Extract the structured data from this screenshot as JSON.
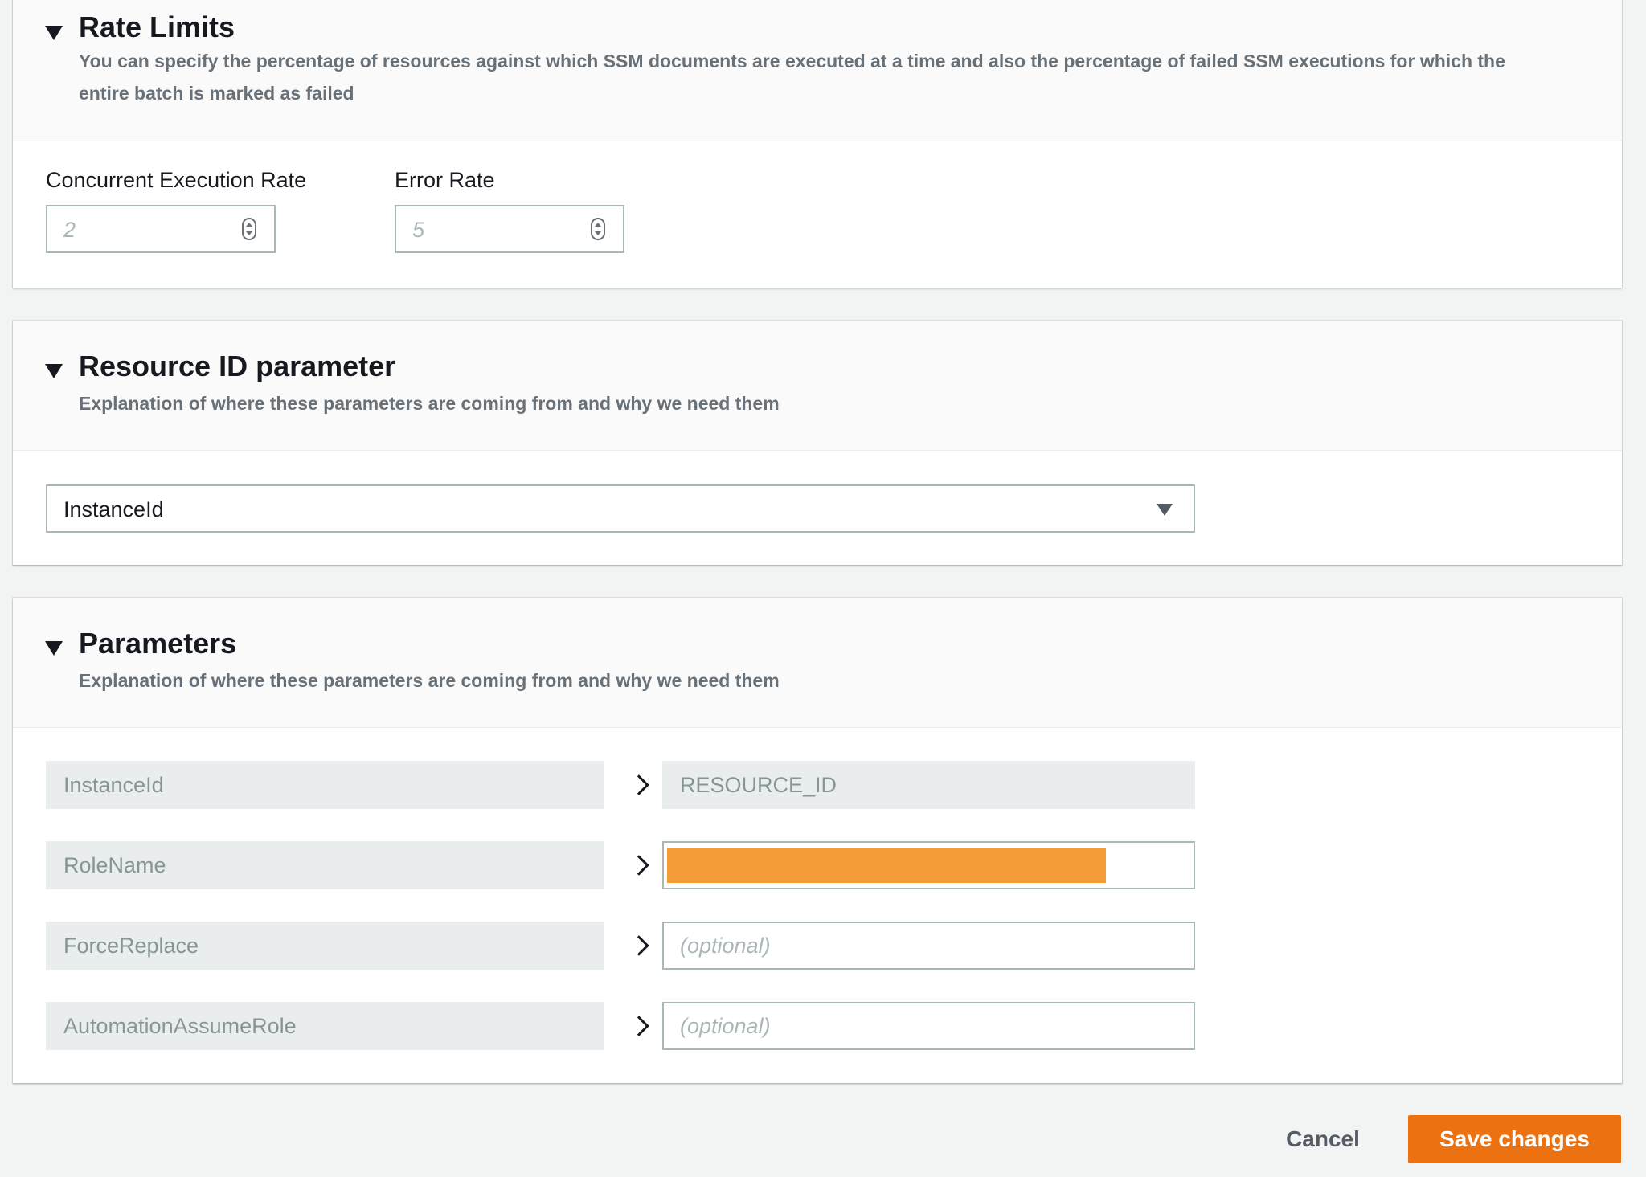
{
  "colors": {
    "page_background": "#f2f3f3",
    "panel_background": "#ffffff",
    "header_background": "#fafafa",
    "primary_button": "#ec7211",
    "redaction": "#f39c38",
    "readonly_field": "#eaeded"
  },
  "rate_limits": {
    "title": "Rate Limits",
    "description": "You can specify the percentage of resources against which SSM documents are executed at a time and also the percentage of failed SSM executions for which the entire batch is marked as failed",
    "concurrent": {
      "label": "Concurrent Execution Rate",
      "value": "2"
    },
    "error": {
      "label": "Error Rate",
      "value": "5"
    }
  },
  "resource_id": {
    "title": "Resource ID parameter",
    "description": "Explanation of where these parameters are coming from and why we need them",
    "selected": "InstanceId"
  },
  "parameters": {
    "title": "Parameters",
    "description": "Explanation of where these parameters are coming from and why we need them",
    "rows": [
      {
        "name": "InstanceId",
        "value": "RESOURCE_ID"
      },
      {
        "name": "RoleName",
        "value": ""
      },
      {
        "name": "ForceReplace",
        "placeholder": "(optional)"
      },
      {
        "name": "AutomationAssumeRole",
        "placeholder": "(optional)"
      }
    ]
  },
  "footer": {
    "cancel_label": "Cancel",
    "save_label": "Save changes"
  }
}
